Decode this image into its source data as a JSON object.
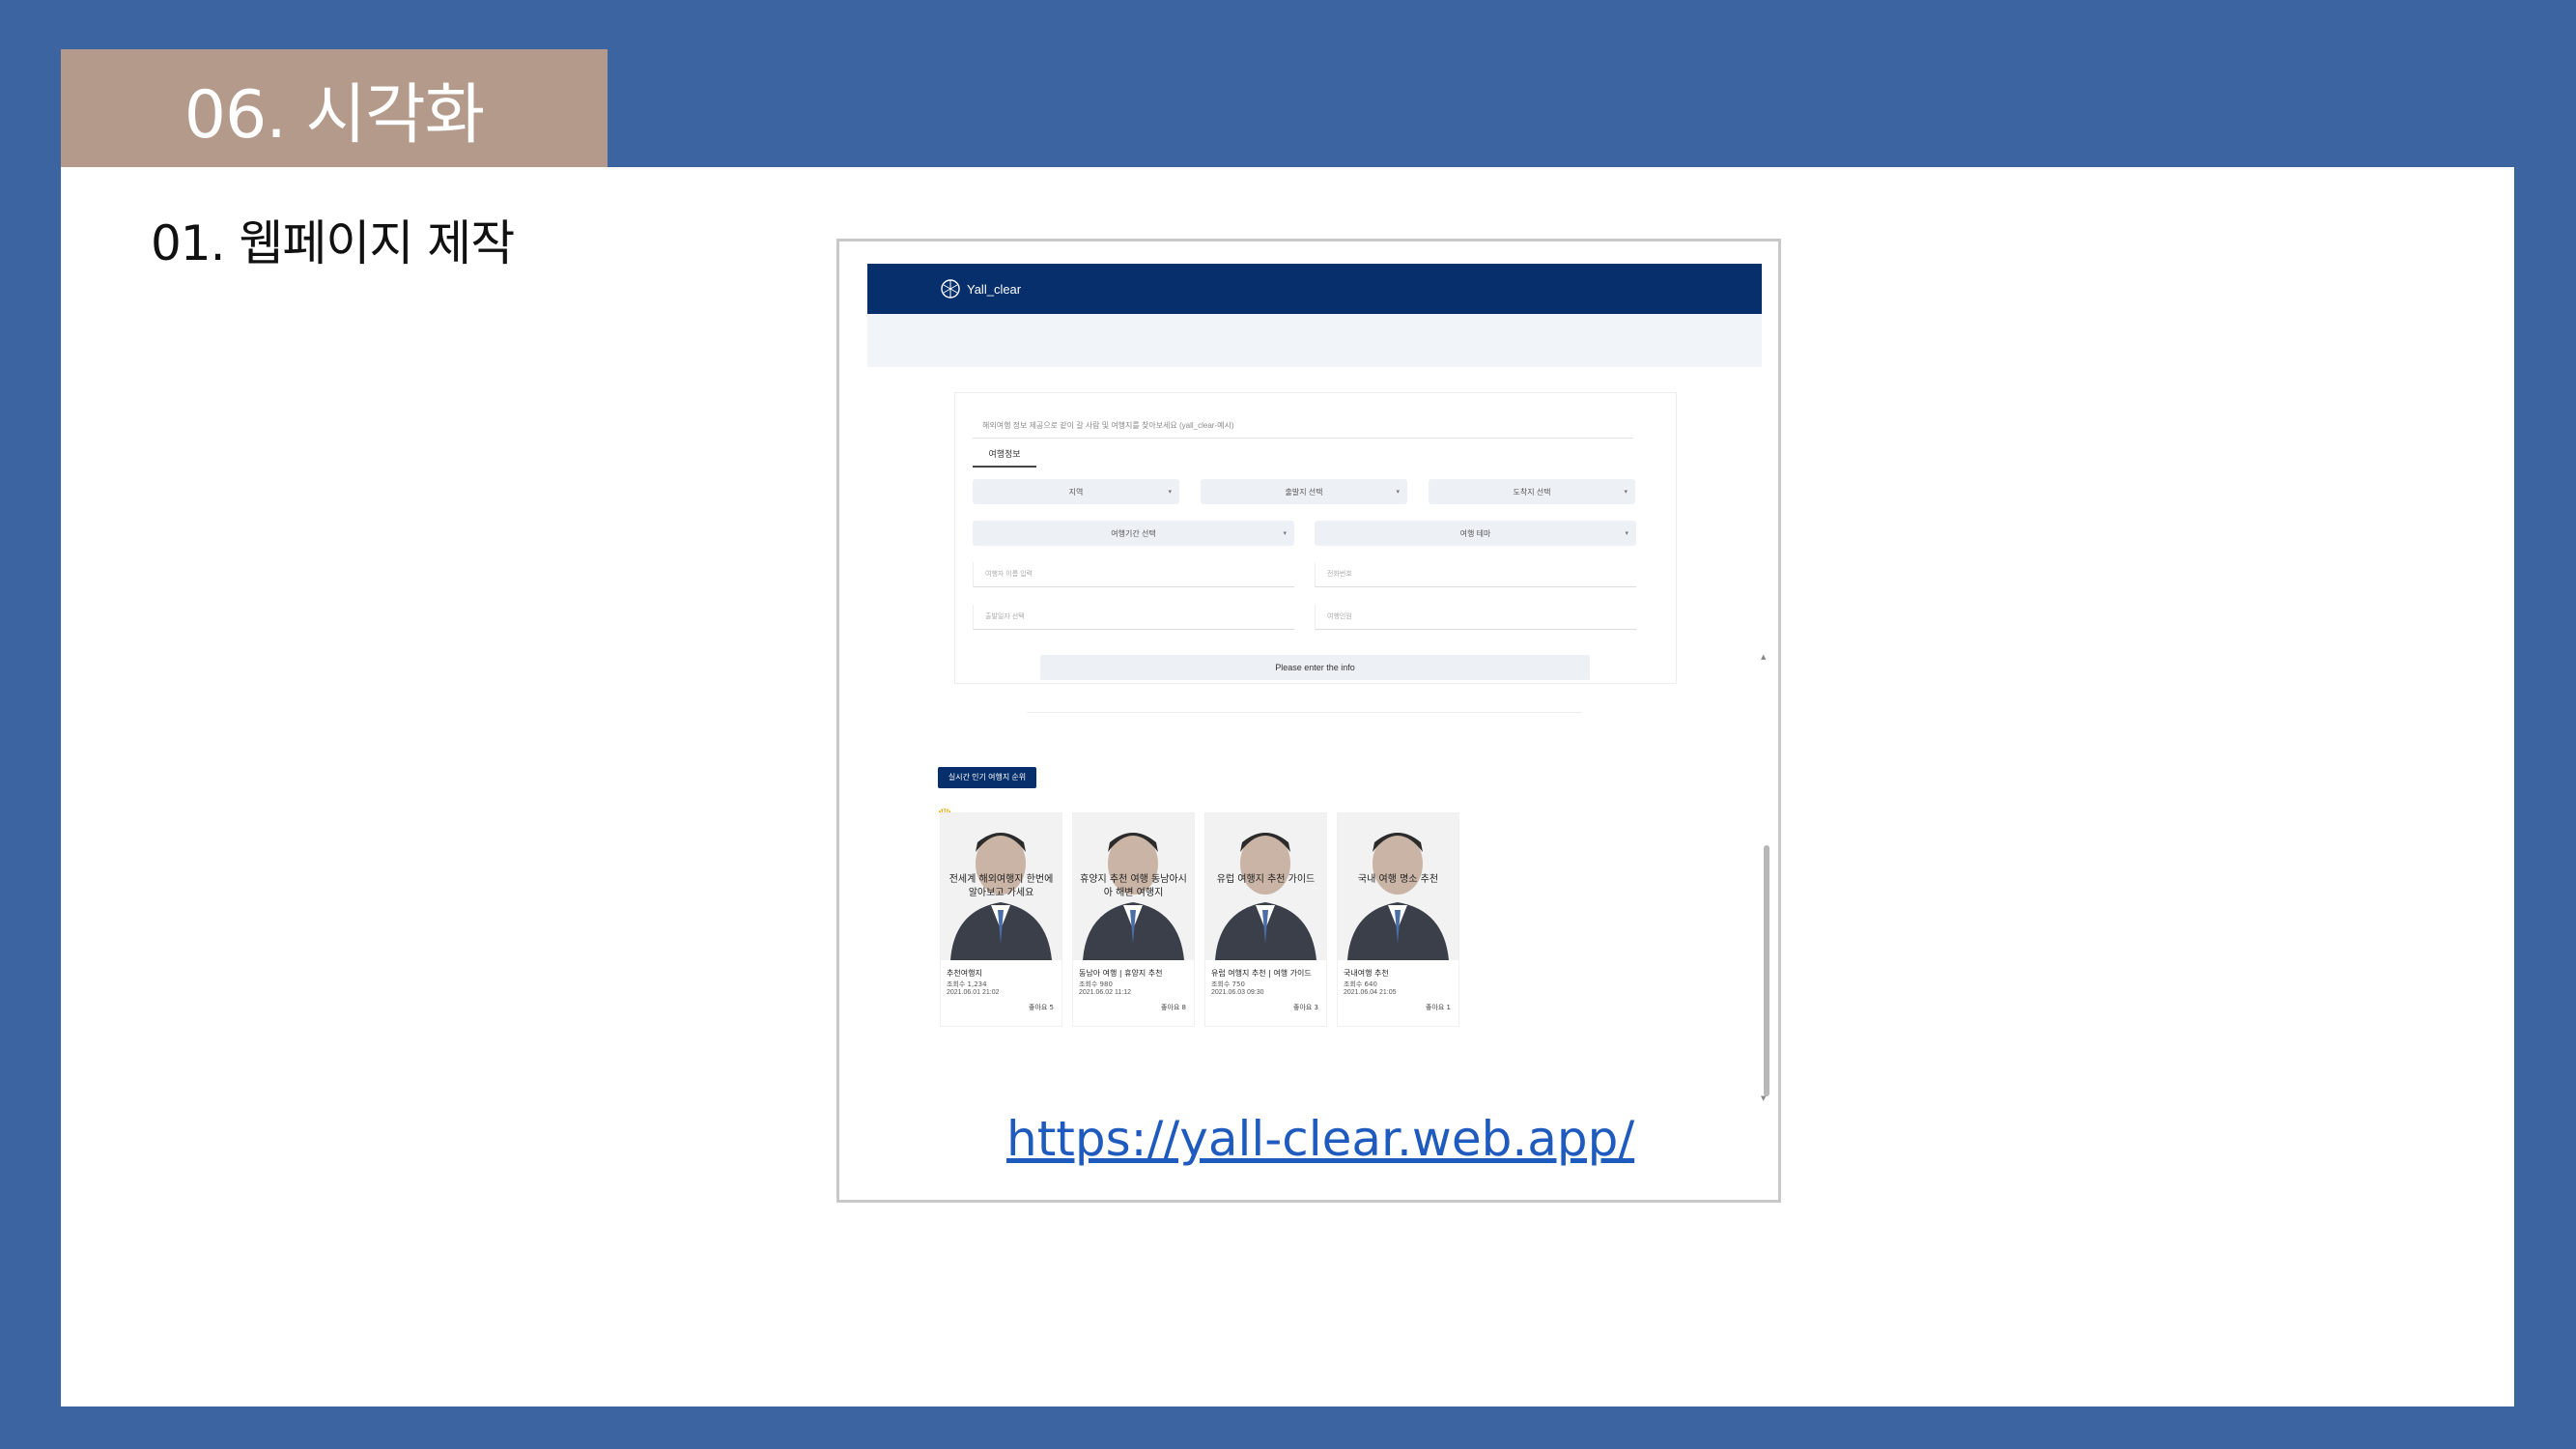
{
  "slide": {
    "section_title": "06. 시각화",
    "subtitle": "01. 웹페이지 제작",
    "link": "https://yall-clear.web.app/"
  },
  "site": {
    "brand": "Yall_clear",
    "form_hint": "해외여행 정보 제공으로 같이 갈 사람 및 여행지를 찾아보세요 (yall_clear-예시)",
    "tab_label": "여행정보",
    "selects_row1": [
      "지역",
      "출발지 선택",
      "도착지 선택"
    ],
    "selects_row2": [
      "여행기간 선택",
      "여행 테마"
    ],
    "inputs_row1": [
      "여행자 이름 입력",
      "전화번호"
    ],
    "inputs_row2": [
      "출발일자 선택",
      "여행인원"
    ],
    "submit_label": "Please enter the info",
    "ranking_badge": "실시간 인기 여행지 순위",
    "crown_icon": "crown-icon"
  },
  "cards": [
    {
      "overlay": "전세계 해외여행지 한번에 알아보고 가세요",
      "line1": "추천여행지",
      "line2": "조회수 1,234",
      "line3": "2021.06.01 21:02",
      "likes": "좋아요 5"
    },
    {
      "overlay": "휴양지 추천 여행 동남아시아 해변 여행지",
      "line1": "동남아 여행 | 휴양지 추천",
      "line2": "조회수 980",
      "line3": "2021.06.02 11:12",
      "likes": "좋아요 8"
    },
    {
      "overlay": "유럽 여행지 추천 가이드",
      "line1": "유럽 여행지 추천 | 여행 가이드",
      "line2": "조회수 750",
      "line3": "2021.06.03 09:30",
      "likes": "좋아요 3"
    },
    {
      "overlay": "국내 여행 명소 추천",
      "line1": "국내여행 추천",
      "line2": "조회수 640",
      "line3": "2021.06.04 21:05",
      "likes": "좋아요 1"
    }
  ],
  "colors": {
    "background": "#3b64a0",
    "section_tab": "#b39a8a",
    "nav": "#062f6b",
    "link": "#1f5bbf"
  }
}
